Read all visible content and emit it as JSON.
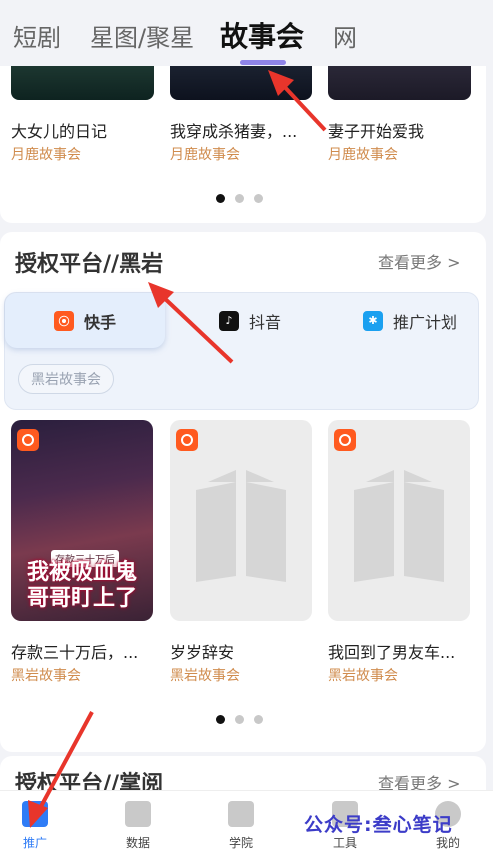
{
  "top_tabs": [
    {
      "label": "短剧"
    },
    {
      "label": "星图/聚星"
    },
    {
      "label": "故事会",
      "active": true
    },
    {
      "label": "网"
    }
  ],
  "story_section": {
    "books": [
      {
        "title": "大女儿的日记",
        "source": "月鹿故事会"
      },
      {
        "title": "我穿成杀猪妻，...",
        "source": "月鹿故事会"
      },
      {
        "title": "妻子开始爱我",
        "source": "月鹿故事会"
      }
    ],
    "page_index": 0,
    "page_count": 3
  },
  "auth_section": {
    "title": "授权平台//黑岩",
    "more_label": "查看更多 >",
    "platform_tabs": [
      {
        "label": "快手",
        "icon": "kuaishou-icon",
        "active": true
      },
      {
        "label": "抖音",
        "icon": "douyin-icon"
      },
      {
        "label": "推广计划",
        "icon": "promotion-plan-icon"
      }
    ],
    "filter_chip": "黑岩故事会",
    "books": [
      {
        "title": "存款三十万后，...",
        "source": "黑岩故事会",
        "cover_text": "我被吸血鬼哥哥盯上了",
        "cover_sub": "存款三十万后"
      },
      {
        "title": "岁岁辞安",
        "source": "黑岩故事会"
      },
      {
        "title": "我回到了男友车...",
        "source": "黑岩故事会"
      }
    ],
    "page_index": 0,
    "page_count": 3
  },
  "next_section": {
    "title": "授权平台//掌阅",
    "more_label": "查看更多 >"
  },
  "bottom_nav": [
    {
      "label": "推广",
      "icon": "promote-icon",
      "active": true
    },
    {
      "label": "数据",
      "icon": "data-chart-icon"
    },
    {
      "label": "学院",
      "icon": "academy-icon"
    },
    {
      "label": "工具",
      "icon": "tools-icon"
    },
    {
      "label": "我的",
      "icon": "profile-icon"
    }
  ],
  "watermark": "公众号:叁心笔记",
  "colors": {
    "accent": "#2f7cf6",
    "source_text": "#d08c4e",
    "tab_indicator": "#8f84e8",
    "arrow": "#e8352b",
    "kuaishou": "#ff5a1f"
  }
}
